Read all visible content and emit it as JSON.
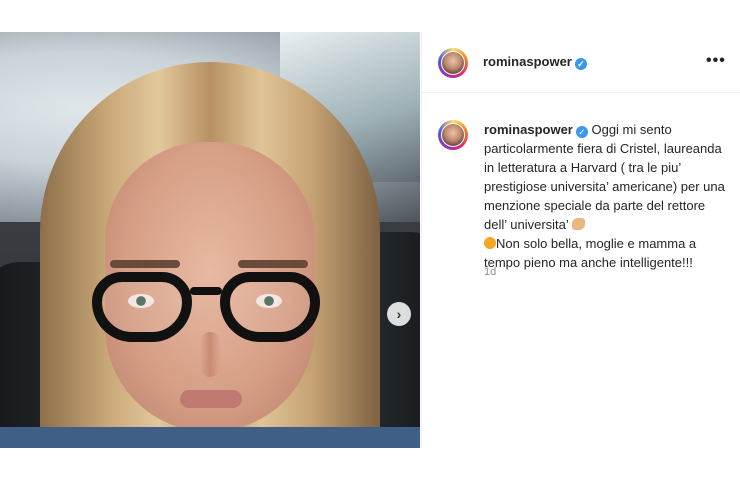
{
  "post": {
    "username": "rominaspower",
    "caption_text": "Oggi mi sento particolarmente fiera di Cristel, laureanda in letteratura a Harvard ( tra le piu’ prestigiose universita’ americane) per una menzione speciale da parte del rettore dell’ universita’",
    "caption_text_2": "Non solo bella, moglie e mamma a tempo pieno ma anche intelligente!!!",
    "timestamp": "1d",
    "more_label": "•••",
    "verified_mark": "✓",
    "next_label": "›"
  },
  "icons": {
    "verified": "verified-badge-icon",
    "more": "more-options-icon",
    "next": "chevron-right-icon"
  },
  "colors": {
    "verified": "#3897f0",
    "timestamp": "#8e8e8e",
    "text": "#262626"
  }
}
